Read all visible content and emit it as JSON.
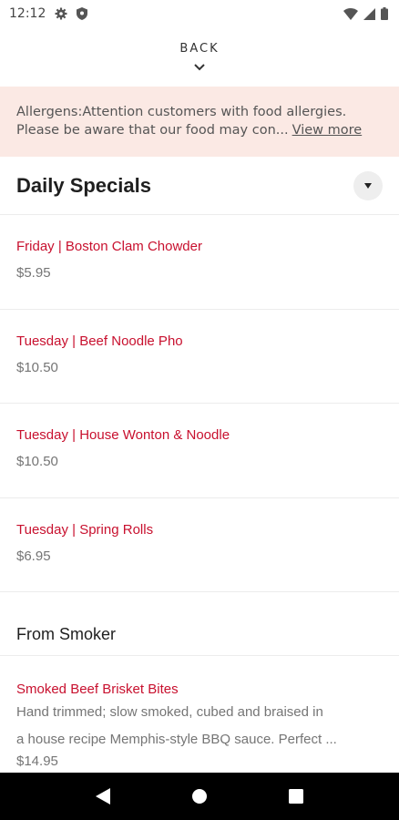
{
  "status_bar": {
    "time": "12:12",
    "left_icons": [
      "gear-icon",
      "shield-icon"
    ],
    "right_icons": [
      "wifi-icon",
      "signal-icon",
      "battery-icon"
    ]
  },
  "back": {
    "label": "BACK",
    "icon": "chevron-down-icon"
  },
  "allergen_banner": {
    "line1": "Allergens:Attention customers with food allergies.",
    "line2": "Please be aware that our food may con...",
    "link": "View more",
    "background": "#fbe9e4"
  },
  "section": {
    "title": "Daily Specials",
    "toggle_icon": "caret-down-icon"
  },
  "daily_specials": [
    {
      "name": "Friday | Boston Clam Chowder",
      "price": "$5.95"
    },
    {
      "name": "Tuesday | Beef Noodle Pho",
      "price": "$10.50"
    },
    {
      "name": "Tuesday | House Wonton & Noodle",
      "price": "$10.50"
    },
    {
      "name": "Tuesday | Spring Rolls",
      "price": "$6.95"
    }
  ],
  "subsection": {
    "title": "From Smoker"
  },
  "smoker_items": [
    {
      "name": "Smoked Beef Brisket Bites",
      "desc_line1": "Hand trimmed; slow smoked, cubed and braised in",
      "desc_line2": "a house recipe Memphis-style BBQ sauce. Perfect ...",
      "price": "$14.95"
    }
  ],
  "colors": {
    "accent": "#c8102e",
    "price": "#757575",
    "nav_bar": "#000000"
  },
  "nav_bar": {
    "buttons": [
      "back-triangle-icon",
      "home-circle-icon",
      "recents-square-icon"
    ]
  }
}
